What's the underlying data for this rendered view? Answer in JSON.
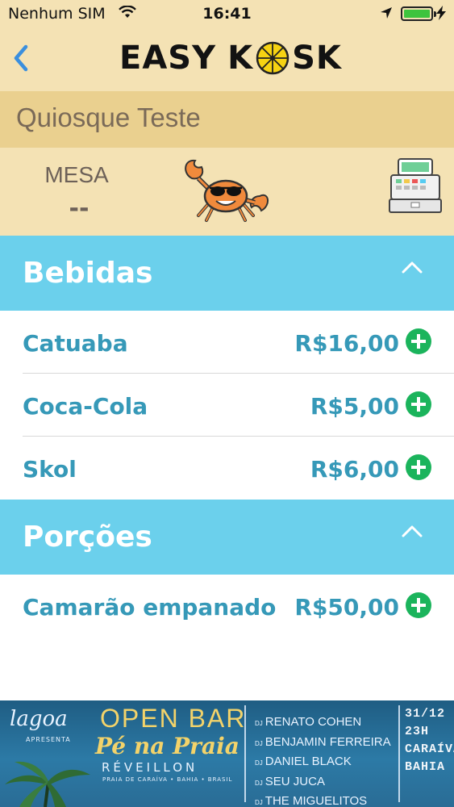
{
  "status_bar": {
    "carrier": "Nenhum SIM",
    "time": "16:41",
    "battery_color": "#3ec43e"
  },
  "nav": {
    "back_icon": "chevron-left-icon",
    "logo_word1": "EASY",
    "logo_word2_a": "K",
    "logo_word2_b": "SK",
    "logo_icon": "beach-umbrella-icon"
  },
  "kiosk": {
    "name": "Quiosque Teste"
  },
  "table": {
    "label": "MESA",
    "value": "--",
    "mascot_icon": "crab-icon",
    "register_icon": "cash-register-icon"
  },
  "sections": [
    {
      "title": "Bebidas",
      "expanded": true,
      "items": [
        {
          "name": "Catuaba",
          "price": "R$16,00"
        },
        {
          "name": "Coca-Cola",
          "price": "R$5,00"
        },
        {
          "name": "Skol",
          "price": "R$6,00"
        }
      ]
    },
    {
      "title": "Porções",
      "expanded": true,
      "items": [
        {
          "name": "Camarão empanado",
          "price": "R$50,00"
        }
      ]
    }
  ],
  "banner": {
    "brand": "lagoa",
    "presents": "APRESENTA",
    "headline": "OPEN BAR",
    "event": "Pé na Praia",
    "subtitle": "RÉVEILLON",
    "location": "PRAIA DE CARAÍVA • BAHIA • BRASIL",
    "dj_prefix": "DJ",
    "djs": [
      "RENATO COHEN",
      "BENJAMIN FERREIRA",
      "DANIEL BLACK",
      "SEU JUCA",
      "THE MIGUELITOS"
    ],
    "date": "31/12",
    "time": "23H",
    "city": "CARAÍVA",
    "state": "BAHIA"
  },
  "colors": {
    "header_bg": "#f4e2b4",
    "title_bar_bg": "#ead08f",
    "section_bg": "#6bd0ec",
    "item_text": "#3699b8",
    "add_button": "#1bb45c"
  }
}
